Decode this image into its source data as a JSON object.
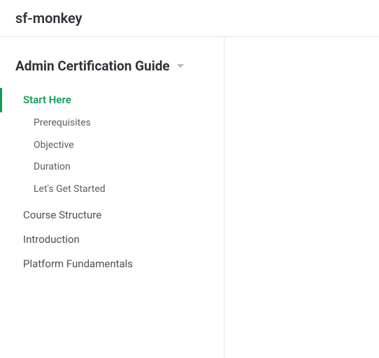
{
  "header": {
    "site_title": "sf-monkey"
  },
  "sidebar": {
    "guide_title": "Admin Certification Guide",
    "nav": {
      "items": [
        {
          "label": "Start Here",
          "active": true,
          "children": [
            {
              "label": "Prerequisites"
            },
            {
              "label": "Objective"
            },
            {
              "label": "Duration"
            },
            {
              "label": "Let's Get Started"
            }
          ]
        },
        {
          "label": "Course Structure"
        },
        {
          "label": "Introduction"
        },
        {
          "label": "Platform Fundamentals"
        }
      ]
    }
  }
}
